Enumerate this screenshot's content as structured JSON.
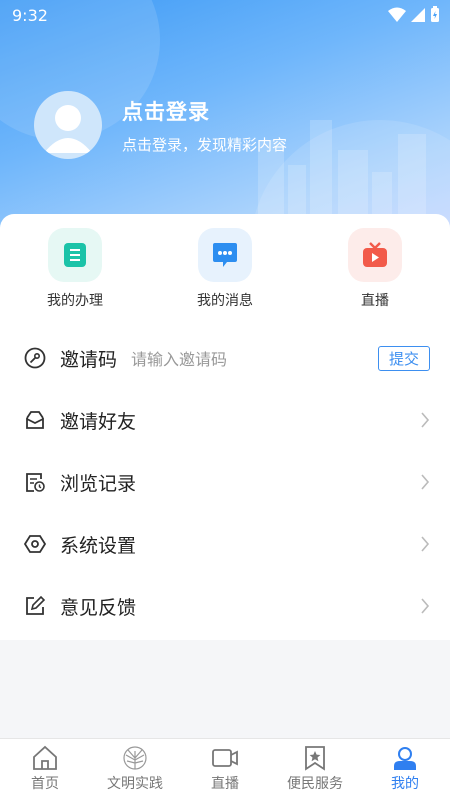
{
  "status": {
    "time": "9:32"
  },
  "profile": {
    "title": "点击登录",
    "subtitle": "点击登录，发现精彩内容"
  },
  "shortcuts": [
    {
      "label": "我的办理",
      "icon": "list-icon",
      "color": "#1bc3a8"
    },
    {
      "label": "我的消息",
      "icon": "chat-icon",
      "color": "#2d8ef0"
    },
    {
      "label": "直播",
      "icon": "tv-icon",
      "color": "#f25a4a"
    }
  ],
  "menu": {
    "invite_code": {
      "label": "邀请码",
      "placeholder": "请输入邀请码",
      "submit": "提交"
    },
    "items": [
      {
        "label": "邀请好友",
        "icon": "envelope-icon"
      },
      {
        "label": "浏览记录",
        "icon": "history-icon"
      },
      {
        "label": "系统设置",
        "icon": "settings-icon"
      },
      {
        "label": "意见反馈",
        "icon": "edit-icon"
      }
    ]
  },
  "tabs": [
    {
      "label": "首页",
      "icon": "home-icon"
    },
    {
      "label": "文明实践",
      "icon": "emblem-icon"
    },
    {
      "label": "直播",
      "icon": "camera-icon"
    },
    {
      "label": "便民服务",
      "icon": "bookmark-star-icon"
    },
    {
      "label": "我的",
      "icon": "user-icon",
      "active": true
    }
  ],
  "colors": {
    "accent": "#2f7ff0",
    "header": "#4aa2f7"
  }
}
